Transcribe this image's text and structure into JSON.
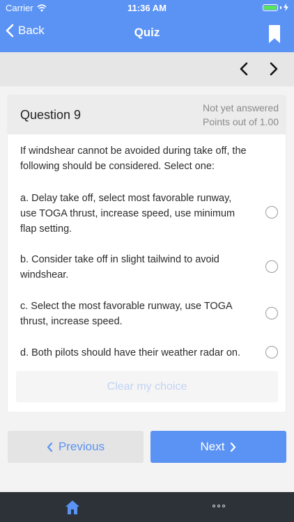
{
  "status_bar": {
    "carrier": "Carrier",
    "time": "11:36 AM"
  },
  "nav": {
    "back_label": "Back",
    "title": "Quiz"
  },
  "question": {
    "title": "Question 9",
    "status": "Not yet answered",
    "points": "Points out of 1.00",
    "text": "If windshear cannot be avoided during take off, the following should be considered. Select one:",
    "options": [
      {
        "label": "a. Delay take off, select most favorable runway, use TOGA thrust, increase speed, use minimum flap setting."
      },
      {
        "label": "b. Consider take off in slight tailwind to avoid windshear."
      },
      {
        "label": "c. Select the most favorable runway, use TOGA thrust, increase speed."
      },
      {
        "label": "d. Both pilots should have their weather radar on."
      }
    ],
    "clear_label": "Clear my choice"
  },
  "footer": {
    "previous_label": "Previous",
    "next_label": "Next"
  },
  "colors": {
    "accent": "#5b93f4",
    "tabbar": "#2d3238"
  },
  "icons": {
    "back": "chevron-left-icon",
    "bookmark": "bookmark-icon",
    "home": "home-icon",
    "more": "more-dots-icon"
  }
}
